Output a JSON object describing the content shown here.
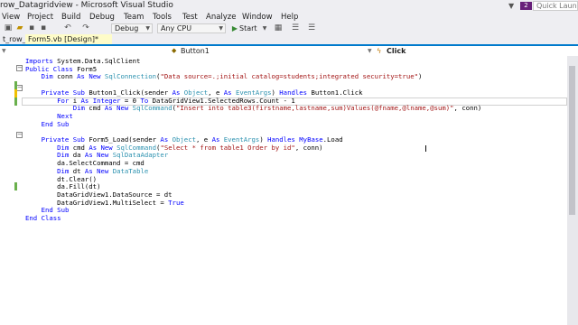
{
  "window": {
    "title": "row_Datagridview - Microsoft Visual Studio",
    "quick_launch": "Quick Launc",
    "notification_count": "2"
  },
  "menu": [
    "View",
    "Project",
    "Build",
    "Debug",
    "Team",
    "Tools",
    "Test",
    "Analyze",
    "Window",
    "Help"
  ],
  "toolbar": {
    "config": "Debug",
    "platform": "Any CPU",
    "start_label": "Start"
  },
  "tabs": {
    "project_tab": "t_row_Datagridview",
    "active_tab": "Form5.vb [Design]*"
  },
  "navbar": {
    "object": "Button1",
    "event": "Click"
  },
  "code": [
    "Imports System.Data.SqlClient",
    "Public Class Form5",
    "    Dim conn As New SqlConnection(\"Data source=.;initial catalog=students;integrated security=true\")",
    "",
    "    Private Sub Button1_Click(sender As Object, e As EventArgs) Handles Button1.Click",
    "        For i As Integer = 0 To DataGridView1.SelectedRows.Count - 1",
    "            Dim cmd As New SqlCommand(\"Insert into table3(firstname,lastname,sum)Values(@fname,@lname,@sum)\", conn)",
    "        Next",
    "    End Sub",
    "",
    "    Private Sub Form5_Load(sender As Object, e As EventArgs) Handles MyBase.Load",
    "        Dim cmd As New SqlCommand(\"Select * from table1 Order by id\", conn)",
    "        Dim da As New SqlDataAdapter",
    "        da.SelectCommand = cmd",
    "        Dim dt As New DataTable",
    "        dt.Clear()",
    "        da.Fill(dt)",
    "        DataGridView1.DataSource = dt",
    "        DataGridView1.MultiSelect = True",
    "    End Sub",
    "End Class"
  ],
  "colors": {
    "keyword": "#0000ff",
    "type": "#2b91af",
    "string": "#a31515",
    "accent": "#007acc",
    "active_tab": "#fefcc8"
  }
}
